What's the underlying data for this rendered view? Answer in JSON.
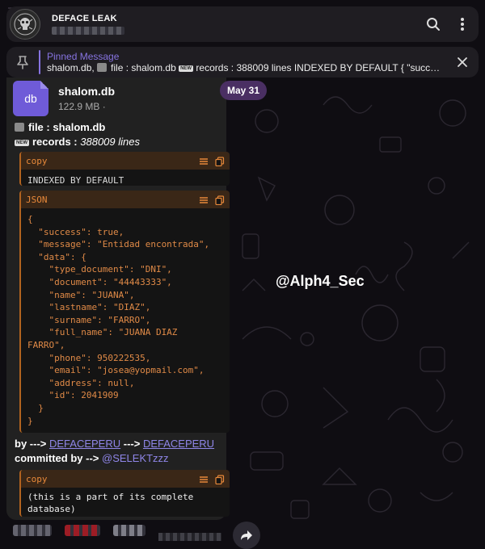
{
  "header": {
    "channel_name": "DEFACE LEAK",
    "subtitle_blurred": "",
    "icons": [
      "search-icon",
      "more-vertical-icon"
    ]
  },
  "pinned": {
    "title": "Pinned Message",
    "prefix": "shalom.db, ",
    "file_part": "file : shalom.db ",
    "new_tag": "NEW",
    "rest": " records : 388009 lines INDEXED BY DEFAULT { \"success\": t..."
  },
  "date_pill": "May 31",
  "file": {
    "icon_label": "db",
    "name": "shalom.db",
    "size": "122.9 MB",
    "size_suffix": "·"
  },
  "caption": {
    "file_line_label": "file : shalom.db",
    "new_tag": "NEW",
    "records_label": "records : ",
    "records_value": "388009 lines"
  },
  "code_blocks": [
    {
      "lang": "copy",
      "content": "INDEXED BY DEFAULT"
    },
    {
      "lang": "JSON",
      "content": "{\n  \"success\": true,\n  \"message\": \"Entidad encontrada\",\n  \"data\": {\n    \"type_document\": \"DNI\",\n    \"document\": \"44443333\",\n    \"name\": \"JUANA\",\n    \"lastname\": \"DIAZ\",\n    \"surname\": \"FARRO\",\n    \"full_name\": \"JUANA DIAZ\nFARRO\",\n    \"phone\": 950222535,\n    \"email\": \"josea@yopmail.com\",\n    \"address\": null,\n    \"id\": 2041909\n  }\n}"
    },
    {
      "lang": "copy",
      "content": "(this is a part of its complete\ndatabase)"
    }
  ],
  "credits": {
    "by_prefix": "by ---> ",
    "by_link_1": "DEFACEPERU",
    "by_arrow": " ---> ",
    "by_link_2": "DEFACEPERU",
    "committed_prefix": "committed by --> ",
    "committed_mention": "@SELEKTzzz"
  },
  "watermark": "@Alph4_Sec",
  "colors": {
    "accent": "#8774e1",
    "code_accent": "#e8893a",
    "bubble": "#212121",
    "date_pill": "#4a2f63"
  }
}
